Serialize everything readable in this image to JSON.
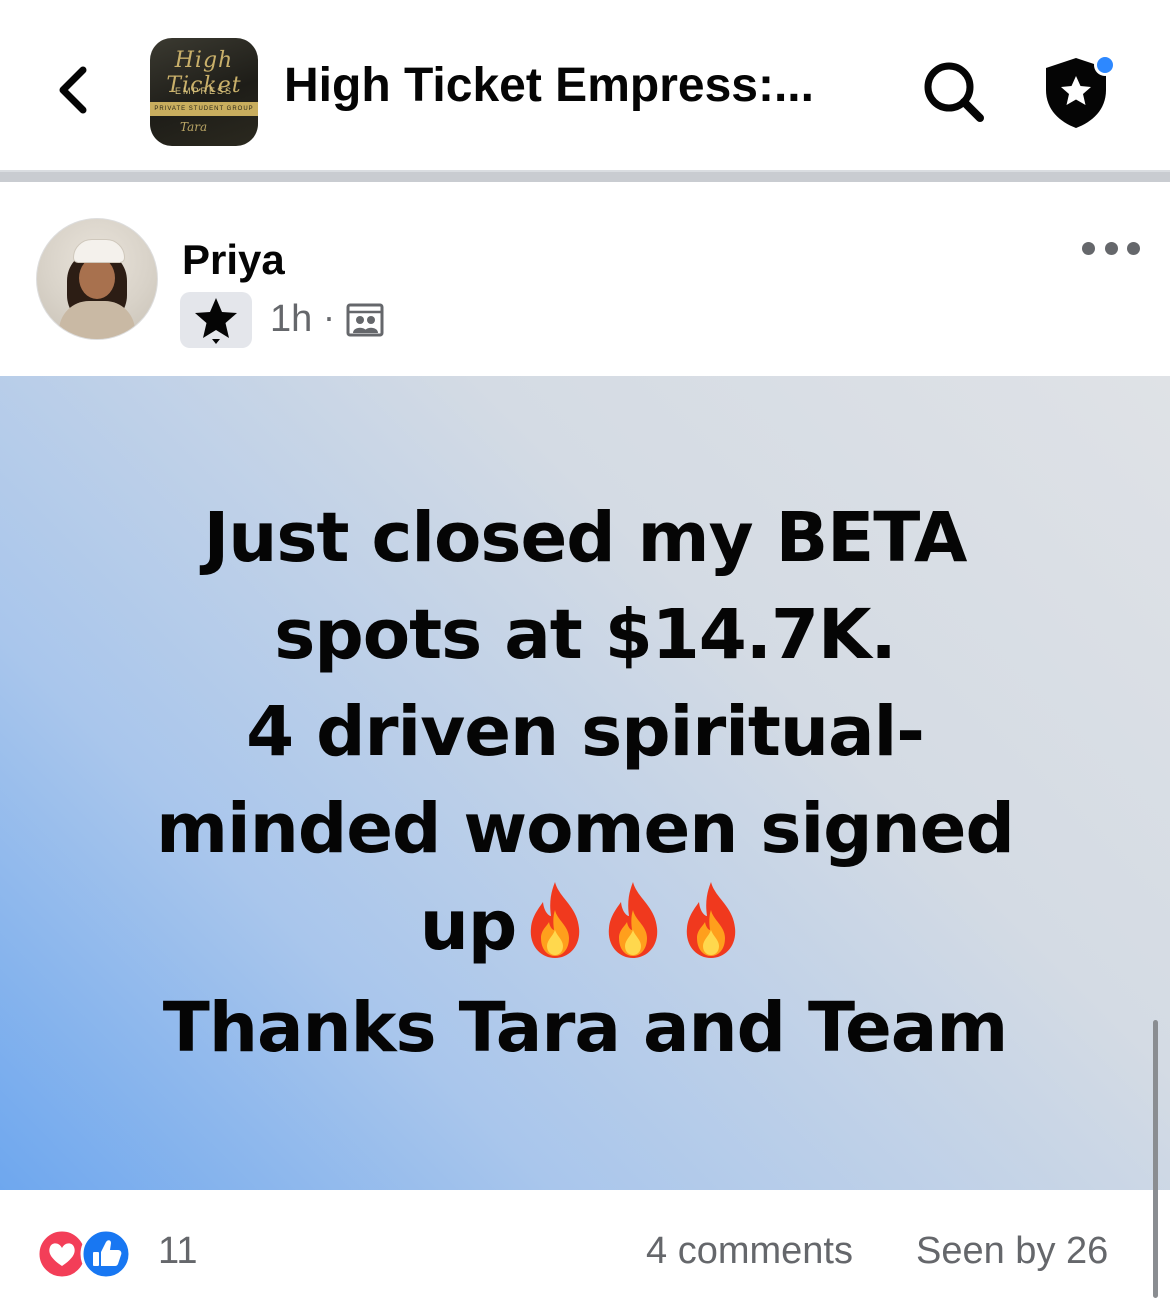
{
  "header": {
    "group_title": "High Ticket Empress:...",
    "group_thumb": {
      "script_text": "High Ticket",
      "word": "EMPRESS",
      "band_text": "PRIVATE STUDENT GROUP",
      "signature": "Tara"
    },
    "icons": {
      "back": "chevron-left-icon",
      "search": "search-icon",
      "admin": "shield-star-icon"
    },
    "notification_dot_color": "#2d88ff"
  },
  "post": {
    "author": "Priya",
    "time": "1h",
    "separator": "·",
    "badge_icon": "star-icon",
    "audience_icon": "group-members-icon",
    "text_lines": [
      "Just closed my BETA",
      "spots at $14.7K.",
      "4 driven spiritual-",
      "minded women signed",
      "up",
      "Thanks Tara and Team"
    ],
    "emoji": "🔥🔥🔥",
    "background_colors": [
      "#dfe2e6",
      "#6ea7ee"
    ]
  },
  "footer": {
    "reaction_icons": [
      "love-reaction-icon",
      "like-reaction-icon"
    ],
    "reaction_count": "11",
    "comments": "4 comments",
    "seen_by": "Seen by 26"
  }
}
